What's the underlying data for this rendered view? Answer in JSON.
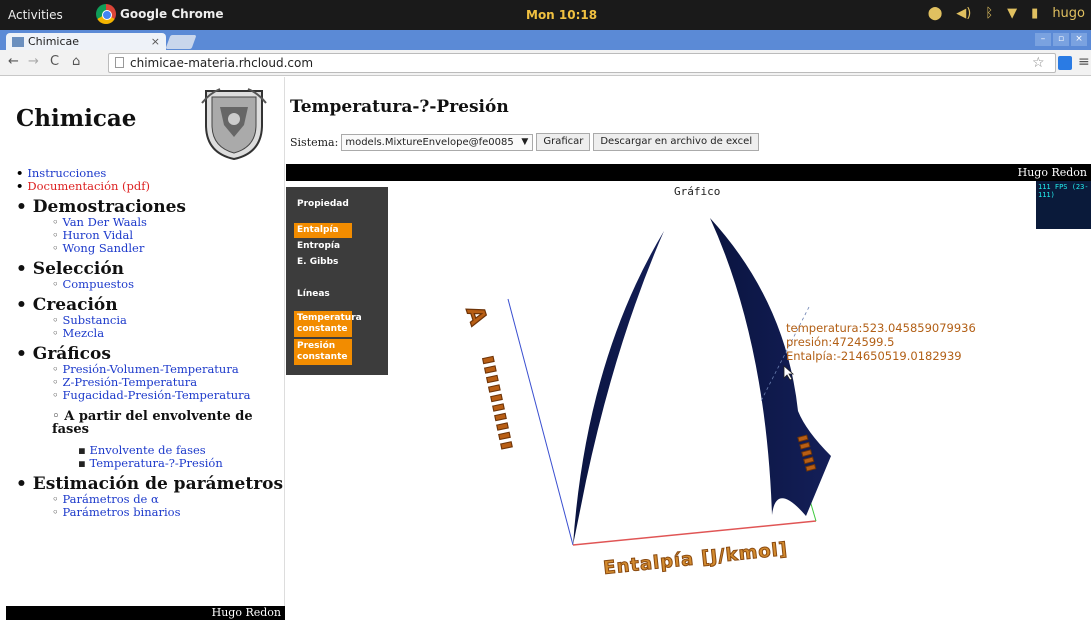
{
  "os": {
    "activities": "Activities",
    "app": "Google Chrome",
    "clock": "Mon 10:18",
    "user": "hugo"
  },
  "browser": {
    "tab_title": "Chimicae",
    "url": "chimicae-materia.rhcloud.com"
  },
  "sidebar": {
    "brand": "Chimicae",
    "top_links": [
      {
        "label": "Instrucciones"
      },
      {
        "label": "Documentación (pdf)"
      }
    ],
    "sections": [
      {
        "title": "Demostraciones",
        "items": [
          "Van Der Waals",
          "Huron Vidal",
          "Wong Sandler"
        ]
      },
      {
        "title": "Selección",
        "items": [
          "Compuestos"
        ]
      },
      {
        "title": "Creación",
        "items": [
          "Substancia",
          "Mezcla"
        ]
      },
      {
        "title": "Gráficos",
        "items": [
          "Presión-Volumen-Temperatura",
          "Z-Presión-Temperatura",
          "Fugacidad-Presión-Temperatura"
        ],
        "subsection": {
          "title": "A partir del envolvente de fases",
          "items": [
            "Envolvente de fases",
            "Temperatura-?-Presión"
          ]
        }
      },
      {
        "title": "Estimación de parámetros",
        "items": [
          "Parámetros de α",
          "Parámetros binarios"
        ]
      }
    ],
    "footer": "Hugo Redon"
  },
  "main": {
    "title": "Temperatura-?-Presión",
    "system_label": "Sistema:",
    "system_value": "models.MixtureEnvelope@fe0085",
    "plot_button": "Graficar",
    "download_button": "Descargar en archivo de excel",
    "bar_text": "Hugo Redon",
    "graph_title": "Gráfico",
    "panel": {
      "prop_header": "Propiedad",
      "props": [
        "Entalpía",
        "Entropía",
        "E. Gibbs"
      ],
      "lines_header": "Líneas",
      "lines": [
        "Temperatura constante",
        "Presión constante"
      ]
    },
    "fps_text": "111 FPS (23-111)",
    "readout": {
      "temperature": "temperatura:523.045859079936",
      "pressure": "presión:4724599.5",
      "enthalpy": "Entalpía:-214650519.0182939"
    },
    "axis_label": "Entalpía [J/kmol]"
  },
  "colors": {
    "surface": "#0a1440",
    "orange": "#f28c00",
    "link": "#1d3acb"
  }
}
